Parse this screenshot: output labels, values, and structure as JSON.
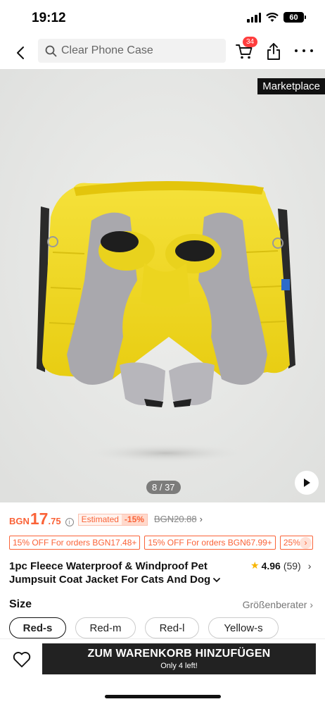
{
  "status": {
    "time": "19:12",
    "battery": "60"
  },
  "header": {
    "search_placeholder": "Clear Phone Case",
    "cart_count": "34"
  },
  "gallery": {
    "tag": "Marketplace",
    "indicator": "8 / 37",
    "image_desc": "yellow-grey-pet-jumpsuit"
  },
  "price": {
    "currency": "BGN",
    "main": "17",
    "cents": ".75",
    "estimated_label": "Estimated",
    "discount": "-15%",
    "original": "BGN20.88"
  },
  "coupons": [
    "15% OFF For orders BGN17.48+",
    "15% OFF For orders BGN67.99+",
    "25% ..."
  ],
  "product": {
    "title_line1": "1pc Fleece Waterproof & Windproof Pet",
    "title_line2": "Jumpsuit Coat Jacket For Cats And Dog",
    "rating": "4.96",
    "review_count": "(59)"
  },
  "size": {
    "label": "Size",
    "guide": "Größenberater",
    "options": [
      "Red-s",
      "Red-m",
      "Red-l",
      "Yellow-s"
    ],
    "selected": "Red-s"
  },
  "bottom": {
    "add_to_cart": "ZUM WARENKORB HINZUFÜGEN",
    "stock_note": "Only 4 left!"
  },
  "colors": {
    "accent": "#fa6338",
    "button_bg": "#222222",
    "badge": "#ff3d3d",
    "star": "#f7b500"
  }
}
